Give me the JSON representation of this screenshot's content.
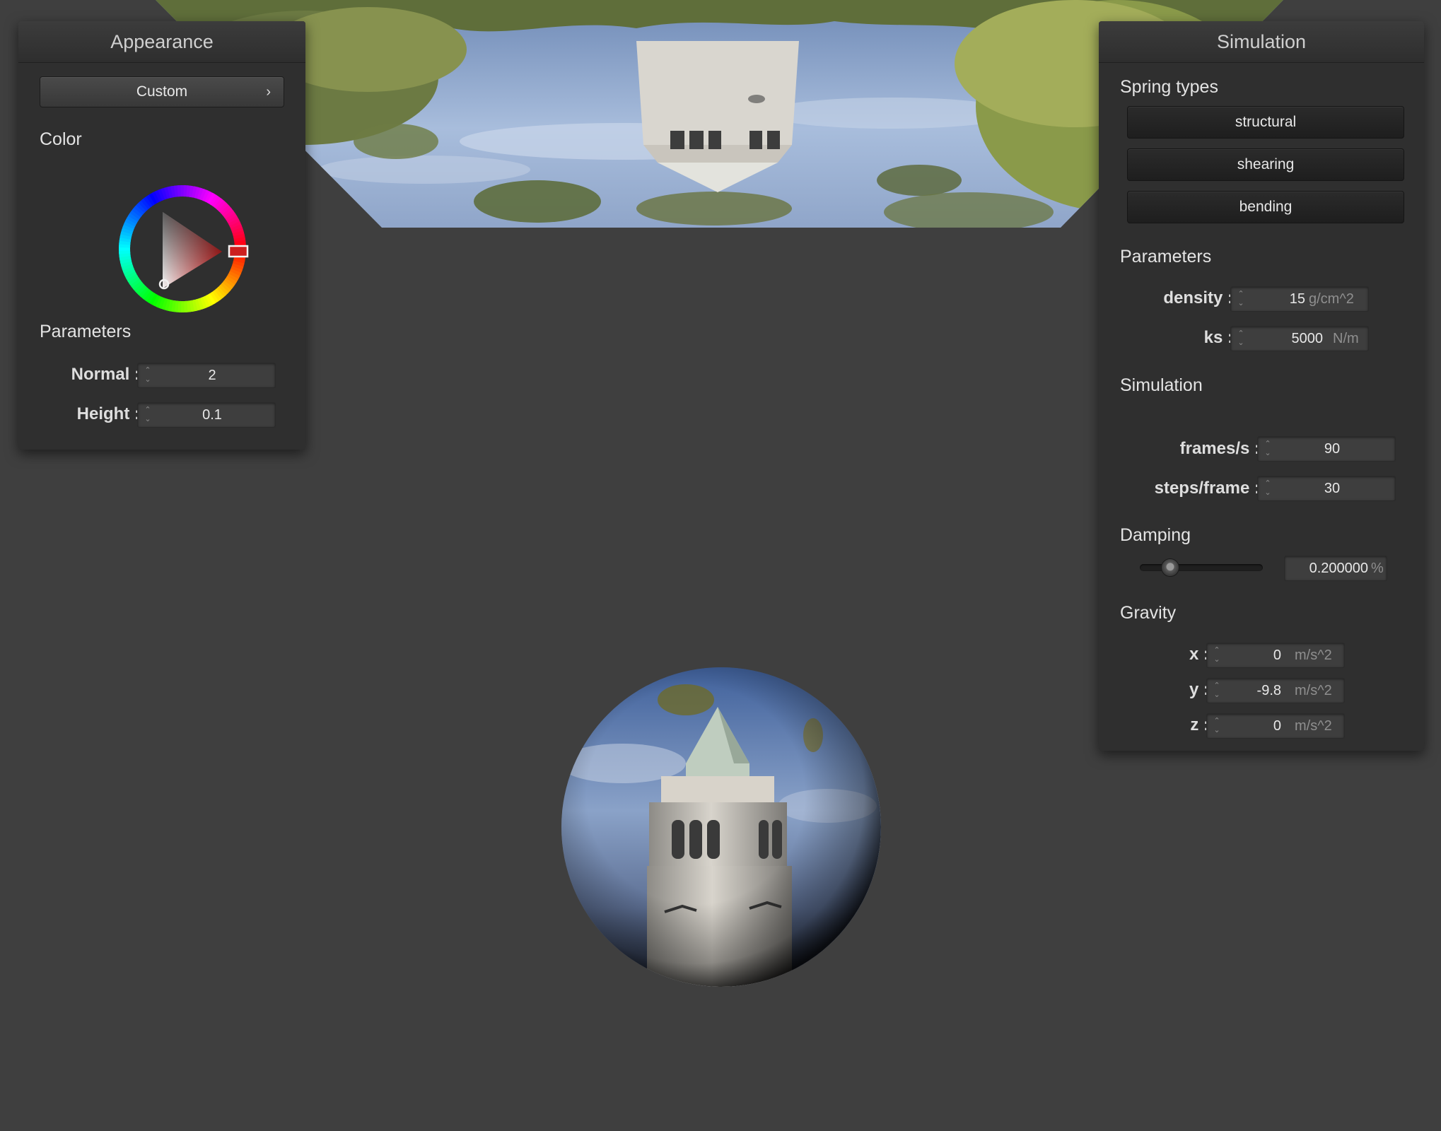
{
  "colors": {
    "background": "#3f3f3f",
    "panel": "#2f2f2f",
    "selected_color": "#cc1f1f"
  },
  "appearance": {
    "title": "Appearance",
    "shader_button": "Custom",
    "color_label": "Color",
    "parameters_label": "Parameters",
    "normal": {
      "label": "Normal :",
      "value": "2"
    },
    "height": {
      "label": "Height :",
      "value": "0.1"
    }
  },
  "simulation": {
    "title": "Simulation",
    "spring_types_label": "Spring types",
    "springs": [
      "structural",
      "shearing",
      "bending"
    ],
    "parameters_label": "Parameters",
    "density": {
      "label": "density :",
      "value": "15",
      "unit": "g/cm^2"
    },
    "ks": {
      "label": "ks :",
      "value": "5000",
      "unit": "N/m"
    },
    "simulation_label": "Simulation",
    "fps": {
      "label": "frames/s :",
      "value": "90"
    },
    "steps": {
      "label": "steps/frame :",
      "value": "30"
    },
    "damping_label": "Damping",
    "damping": {
      "value": "0.200000",
      "unit": "%",
      "slider_fraction": 0.2
    },
    "gravity_label": "Gravity",
    "gravity": {
      "x": {
        "label": "x :",
        "value": "0",
        "unit": "m/s^2"
      },
      "y": {
        "label": "y :",
        "value": "-9.8",
        "unit": "m/s^2"
      },
      "z": {
        "label": "z :",
        "value": "0",
        "unit": "m/s^2"
      }
    }
  }
}
